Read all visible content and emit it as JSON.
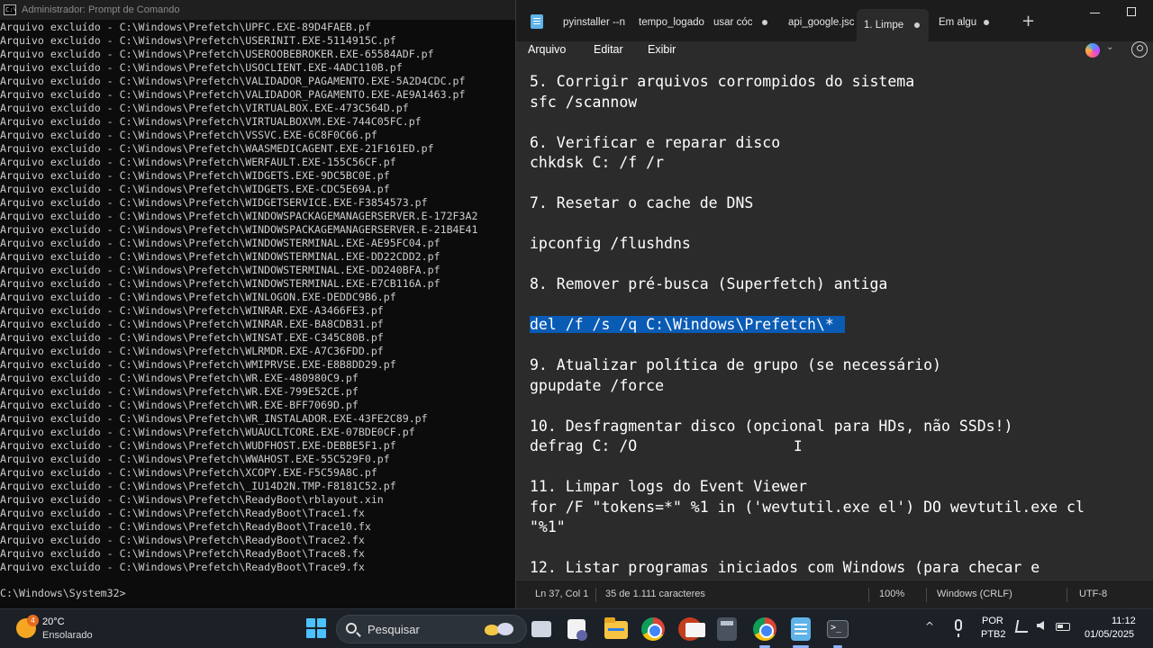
{
  "cmd": {
    "title": "Administrador: Prompt de Comando",
    "lines": [
      "Arquivo excluído - C:\\Windows\\Prefetch\\UPFC.EXE-89D4FAEB.pf",
      "Arquivo excluído - C:\\Windows\\Prefetch\\USERINIT.EXE-5114915C.pf",
      "Arquivo excluído - C:\\Windows\\Prefetch\\USEROOBEBROKER.EXE-65584ADF.pf",
      "Arquivo excluído - C:\\Windows\\Prefetch\\USOCLIENT.EXE-4ADC110B.pf",
      "Arquivo excluído - C:\\Windows\\Prefetch\\VALIDADOR_PAGAMENTO.EXE-5A2D4CDC.pf",
      "Arquivo excluído - C:\\Windows\\Prefetch\\VALIDADOR_PAGAMENTO.EXE-AE9A1463.pf",
      "Arquivo excluído - C:\\Windows\\Prefetch\\VIRTUALBOX.EXE-473C564D.pf",
      "Arquivo excluído - C:\\Windows\\Prefetch\\VIRTUALBOXVM.EXE-744C05FC.pf",
      "Arquivo excluído - C:\\Windows\\Prefetch\\VSSVC.EXE-6C8F0C66.pf",
      "Arquivo excluído - C:\\Windows\\Prefetch\\WAASMEDICAGENT.EXE-21F161ED.pf",
      "Arquivo excluído - C:\\Windows\\Prefetch\\WERFAULT.EXE-155C56CF.pf",
      "Arquivo excluído - C:\\Windows\\Prefetch\\WIDGETS.EXE-9DC5BC0E.pf",
      "Arquivo excluído - C:\\Windows\\Prefetch\\WIDGETS.EXE-CDC5E69A.pf",
      "Arquivo excluído - C:\\Windows\\Prefetch\\WIDGETSERVICE.EXE-F3854573.pf",
      "Arquivo excluído - C:\\Windows\\Prefetch\\WINDOWSPACKAGEMANAGERSERVER.E-172F3A2",
      "Arquivo excluído - C:\\Windows\\Prefetch\\WINDOWSPACKAGEMANAGERSERVER.E-21B4E41",
      "Arquivo excluído - C:\\Windows\\Prefetch\\WINDOWSTERMINAL.EXE-AE95FC04.pf",
      "Arquivo excluído - C:\\Windows\\Prefetch\\WINDOWSTERMINAL.EXE-DD22CDD2.pf",
      "Arquivo excluído - C:\\Windows\\Prefetch\\WINDOWSTERMINAL.EXE-DD240BFA.pf",
      "Arquivo excluído - C:\\Windows\\Prefetch\\WINDOWSTERMINAL.EXE-E7CB116A.pf",
      "Arquivo excluído - C:\\Windows\\Prefetch\\WINLOGON.EXE-DEDDC9B6.pf",
      "Arquivo excluído - C:\\Windows\\Prefetch\\WINRAR.EXE-A3466FE3.pf",
      "Arquivo excluído - C:\\Windows\\Prefetch\\WINRAR.EXE-BA8CDB31.pf",
      "Arquivo excluído - C:\\Windows\\Prefetch\\WINSAT.EXE-C345C80B.pf",
      "Arquivo excluído - C:\\Windows\\Prefetch\\WLRMDR.EXE-A7C36FDD.pf",
      "Arquivo excluído - C:\\Windows\\Prefetch\\WMIPRVSE.EXE-E8B8DD29.pf",
      "Arquivo excluído - C:\\Windows\\Prefetch\\WR.EXE-480980C9.pf",
      "Arquivo excluído - C:\\Windows\\Prefetch\\WR.EXE-799E52CE.pf",
      "Arquivo excluído - C:\\Windows\\Prefetch\\WR.EXE-BFF7069D.pf",
      "Arquivo excluído - C:\\Windows\\Prefetch\\WR_INSTALADOR.EXE-43FE2C89.pf",
      "Arquivo excluído - C:\\Windows\\Prefetch\\WUAUCLTCORE.EXE-07BDE0CF.pf",
      "Arquivo excluído - C:\\Windows\\Prefetch\\WUDFHOST.EXE-DEBBE5F1.pf",
      "Arquivo excluído - C:\\Windows\\Prefetch\\WWAHOST.EXE-55C529F0.pf",
      "Arquivo excluído - C:\\Windows\\Prefetch\\XCOPY.EXE-F5C59A8C.pf",
      "Arquivo excluído - C:\\Windows\\Prefetch\\_IU14D2N.TMP-F8181C52.pf",
      "Arquivo excluído - C:\\Windows\\Prefetch\\ReadyBoot\\rblayout.xin",
      "Arquivo excluído - C:\\Windows\\Prefetch\\ReadyBoot\\Trace1.fx",
      "Arquivo excluído - C:\\Windows\\Prefetch\\ReadyBoot\\Trace10.fx",
      "Arquivo excluído - C:\\Windows\\Prefetch\\ReadyBoot\\Trace2.fx",
      "Arquivo excluído - C:\\Windows\\Prefetch\\ReadyBoot\\Trace8.fx",
      "Arquivo excluído - C:\\Windows\\Prefetch\\ReadyBoot\\Trace9.fx"
    ],
    "prompt": "C:\\Windows\\System32>"
  },
  "notepad": {
    "tabs": [
      {
        "label": "pyinstaller --n",
        "active": false,
        "dot": false
      },
      {
        "label": "tempo_logado",
        "active": false,
        "dot": false
      },
      {
        "label": "usar cóc",
        "active": false,
        "dot": true
      },
      {
        "label": "api_google.jsc",
        "active": false,
        "dot": false
      },
      {
        "label": "1. Limpe",
        "active": true,
        "dot": true
      },
      {
        "label": "Em algu",
        "active": false,
        "dot": true
      }
    ],
    "add_tab": "+",
    "menu": {
      "file": "Arquivo",
      "edit": "Editar",
      "view": "Exibir"
    },
    "lines": [
      "5. Corrigir arquivos corrompidos do sistema",
      "sfc /scannow",
      "",
      "6. Verificar e reparar disco",
      "chkdsk C: /f /r",
      "",
      "7. Resetar o cache de DNS",
      "",
      "ipconfig /flushdns",
      "",
      "8. Remover pré-busca (Superfetch) antiga",
      "",
      "del /f /s /q C:\\Windows\\Prefetch\\*",
      "",
      "9. Atualizar política de grupo (se necessário)",
      "gpupdate /force",
      "",
      "10. Desfragmentar disco (opcional para HDs, não SSDs!)",
      "defrag C: /O",
      "",
      "11. Limpar logs do Event Viewer",
      "for /F \"tokens=*\" %1 in ('wevtutil.exe el') DO wevtutil.exe cl",
      "\"%1\"",
      "",
      "12. Listar programas iniciados com Windows (para checar e"
    ],
    "selected_line": 12,
    "status": {
      "position": "Ln 37, Col 1",
      "selection": "35 de 1.111 caracteres",
      "zoom": "100%",
      "line_ending": "Windows (CRLF)",
      "encoding": "UTF-8"
    }
  },
  "taskbar": {
    "weather_badge": "4",
    "weather_temp": "20°C",
    "weather_desc": "Ensolarado",
    "search_label": "Pesquisar",
    "tray_chevron": "^",
    "lang_top": "POR",
    "lang_bottom": "PTB2",
    "time": "11:12",
    "date": "01/05/2025"
  }
}
